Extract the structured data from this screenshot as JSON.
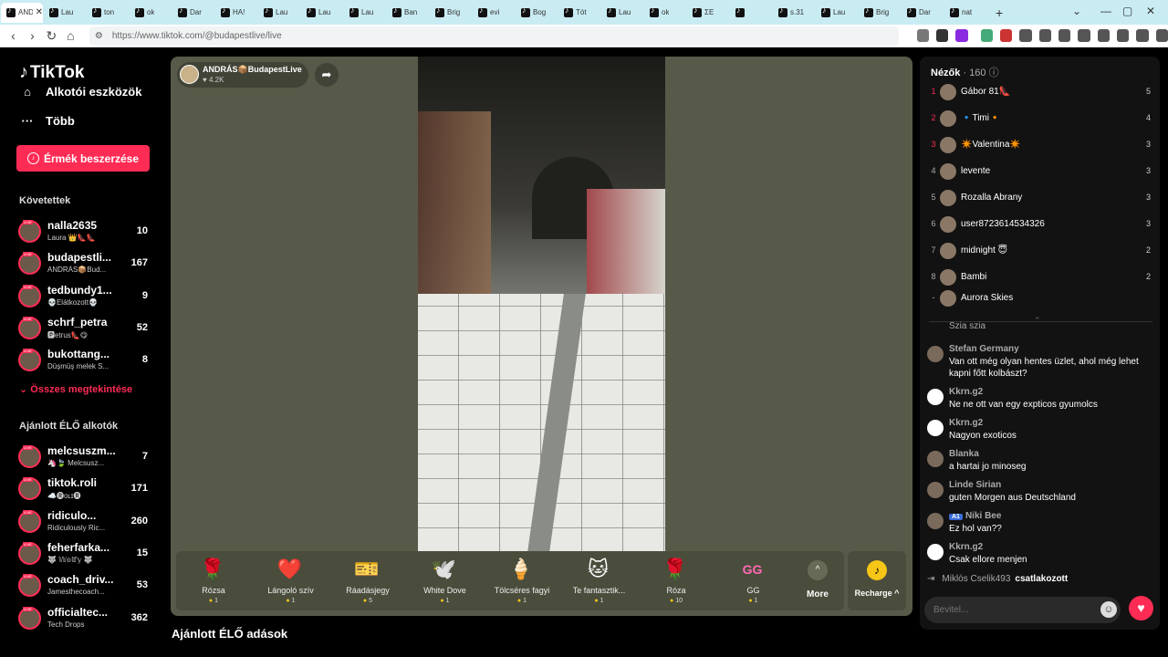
{
  "browser": {
    "tabs": [
      "ANDRÁS",
      "Lau",
      "ton",
      "ok",
      "Dar",
      "HA!",
      "Lau",
      "Lau",
      "Lau",
      "Ban",
      "Brig",
      "evi",
      "Bog",
      "Tót",
      "Lau",
      "ok",
      "ΣE",
      "",
      "s.31",
      "Lau",
      "Brig",
      "Dar",
      "nat"
    ],
    "url": "https://www.tiktok.com/@budapestlive/live"
  },
  "sidebar": {
    "logo": "TikTok",
    "creator_tools": "Alkotói eszközök",
    "more": "Több",
    "buy_coins": "Érmék beszerzése",
    "following_title": "Követettek",
    "following": [
      {
        "name": "nalla2635",
        "sub": "Laura 👑👠👠",
        "count": "10"
      },
      {
        "name": "budapestli...",
        "sub": "ANDRÁS📦Bud...",
        "count": "167"
      },
      {
        "name": "tedbundy1...",
        "sub": "💀Elátkozott💀",
        "count": "9"
      },
      {
        "name": "schrf_petra",
        "sub": "🅿etrus👠😋",
        "count": "52"
      },
      {
        "name": "bukottang...",
        "sub": "Düşmüş melek S...",
        "count": "8"
      }
    ],
    "see_all": "Összes megtekintése",
    "recommended_title": "Ajánlott ÉLŐ alkotók",
    "recommended": [
      {
        "name": "melcsuszm...",
        "sub": "🦄🍃 Melcsusz...",
        "count": "7"
      },
      {
        "name": "tiktok.roli",
        "sub": "☁️🅡ᴏʟɪ🅡",
        "count": "171"
      },
      {
        "name": "ridiculo...",
        "sub": "Ridiculously Ric...",
        "count": "260"
      },
      {
        "name": "feherfarka...",
        "sub": "🐺 𝕎𝕠𝕝𝕗𝕪 🐺",
        "count": "15"
      },
      {
        "name": "coach_driv...",
        "sub": "Jamesthecoach...",
        "count": "53"
      },
      {
        "name": "officialtec...",
        "sub": "Tech Drops",
        "count": "362"
      }
    ]
  },
  "stream": {
    "host": "ANDRÁS📦BudapestLive",
    "likes": "♥ 4.2K",
    "gifts": [
      {
        "name": "Rózsa",
        "price": "1",
        "icon": "🌹"
      },
      {
        "name": "Lángoló szív",
        "price": "1",
        "icon": "❤️"
      },
      {
        "name": "Ráadásjegy",
        "price": "5",
        "icon": "🎫"
      },
      {
        "name": "White Dove",
        "price": "1",
        "icon": "🕊️"
      },
      {
        "name": "Tölcséres fagyi",
        "price": "1",
        "icon": "🍦"
      },
      {
        "name": "Te fantasztik...",
        "price": "1",
        "icon": "🐱"
      },
      {
        "name": "Róza",
        "price": "10",
        "icon": "🌹"
      },
      {
        "name": "GG",
        "price": "1",
        "icon": "GG"
      }
    ],
    "more_label": "More",
    "recharge_label": "Recharge ^"
  },
  "suggested_title": "Ajánlott ÉLŐ adások",
  "viewers": {
    "title": "Nézők",
    "count": "· 160",
    "list": [
      {
        "rank": "1",
        "name": "Gábor 81👠",
        "score": "5"
      },
      {
        "rank": "2",
        "name": "🔹Timi🔸",
        "score": "4"
      },
      {
        "rank": "3",
        "name": "✴️Valentina✴️",
        "score": "3"
      },
      {
        "rank": "4",
        "name": "levente",
        "score": "3"
      },
      {
        "rank": "5",
        "name": "Rozalla Abrany",
        "score": "3"
      },
      {
        "rank": "6",
        "name": "user8723614534326",
        "score": "3"
      },
      {
        "rank": "7",
        "name": "midnight 😇",
        "score": "2"
      },
      {
        "rank": "8",
        "name": "Bambi",
        "score": "2"
      },
      {
        "rank": "-",
        "name": "Aurora Skies",
        "score": ""
      }
    ]
  },
  "chat": {
    "messages": [
      {
        "user": "",
        "text": "Szia szia"
      },
      {
        "user": "Stefan Germany",
        "text": "Van ott még olyan hentes üzlet, ahol még lehet kapni főtt kolbászt?"
      },
      {
        "user": "Kkrn.g2",
        "text": "Ne ne ott van egy expticos gyumolcs"
      },
      {
        "user": "Kkrn.g2",
        "text": "Nagyon exoticos"
      },
      {
        "user": "Blanka",
        "text": "a hartai jo minoseg"
      },
      {
        "user": "Linde Sirian",
        "text": "guten Morgen aus Deutschland"
      },
      {
        "user": "Niki Bee",
        "badge": "A1",
        "text": "Ez hol van??"
      },
      {
        "user": "Kkrn.g2",
        "text": "Csak ellore menjen"
      }
    ],
    "joined_user": "Miklós Cselik493",
    "joined_text": "csatlakozott",
    "input_placeholder": "Bevitel..."
  }
}
